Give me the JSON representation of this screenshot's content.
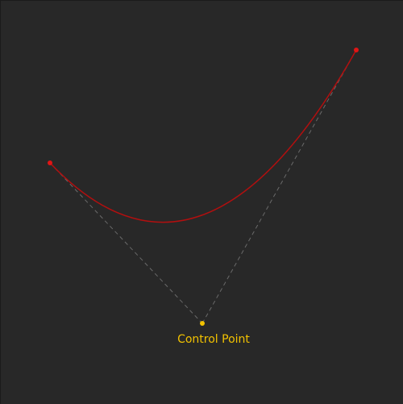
{
  "canvas": {
    "background": "#282828"
  },
  "curve": {
    "color": "#b20f0f",
    "endpoint_color": "#e01515"
  },
  "control_point": {
    "label": "Control Point",
    "color": "#f2c200"
  },
  "guide_lines": {
    "color": "#6a6a6a",
    "style": "dashed"
  }
}
